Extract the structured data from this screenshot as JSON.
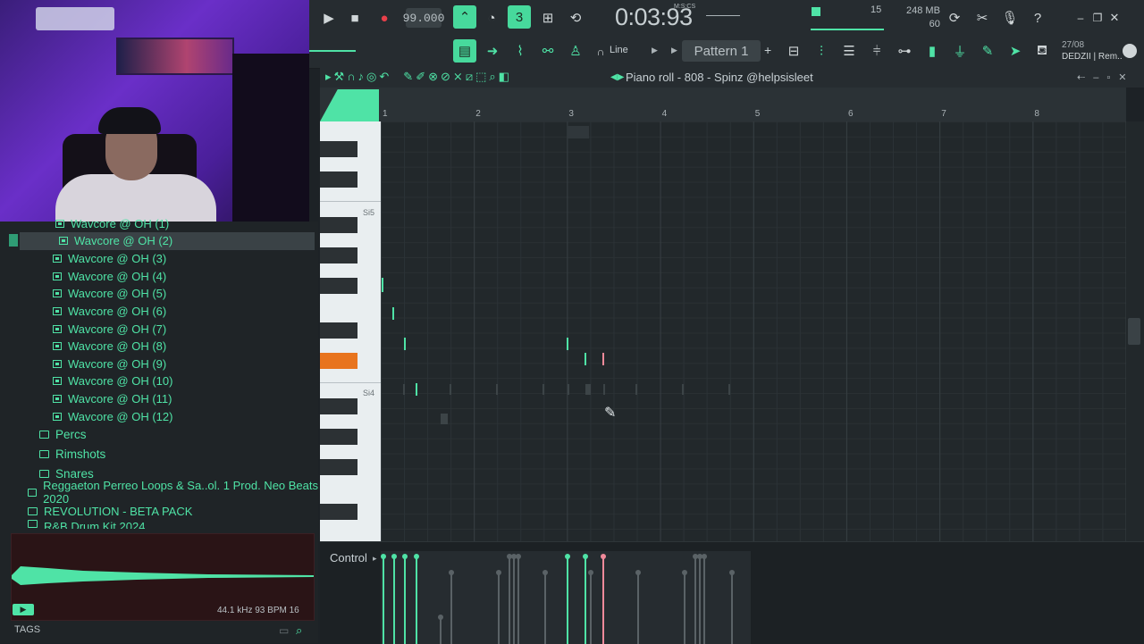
{
  "transport": {
    "tempo": "99.000",
    "time": "0:03:93",
    "time_label": "M:S:CS",
    "pattern": "Pattern 1",
    "snap": "Line"
  },
  "status": {
    "cpu": "15",
    "memory": "248 MB",
    "polyphony": "60"
  },
  "hint_panel": {
    "date": "27/08",
    "user": "DEDZII | Rem.."
  },
  "browser": {
    "top_clip": "Wavcore @ OH (1)",
    "items": [
      "Wavcore @ OH (2)",
      "Wavcore @ OH (3)",
      "Wavcore @ OH (4)",
      "Wavcore @ OH (5)",
      "Wavcore @ OH (6)",
      "Wavcore @ OH (7)",
      "Wavcore @ OH (8)",
      "Wavcore @ OH (9)",
      "Wavcore @ OH (10)",
      "Wavcore @ OH (11)",
      "Wavcore @ OH (12)"
    ],
    "selected_index": 0,
    "folders": [
      "Percs",
      "Rimshots",
      "Snares"
    ],
    "packs": [
      "Reggaeton Perreo Loops & Sa..ol. 1 Prod. Neo Beats 2020",
      "REVOLUTION - BETA PACK"
    ],
    "bottom_clip": "R&B Drum Kit 2024",
    "preview_info": "44.1 kHz 93 BPM 16",
    "tags_label": "TAGS"
  },
  "piano_roll": {
    "title": "Piano roll - 808 - Spinz @helpsisleet",
    "bars": [
      "1",
      "2",
      "3",
      "4",
      "5",
      "6",
      "7",
      "8"
    ],
    "key_labels": [
      "Si5",
      "Si4"
    ],
    "control_label": "Control"
  },
  "colors": {
    "accent": "#4fe3a6",
    "highlight_key": "#e8741e",
    "selected_note": "#f08a9a"
  }
}
